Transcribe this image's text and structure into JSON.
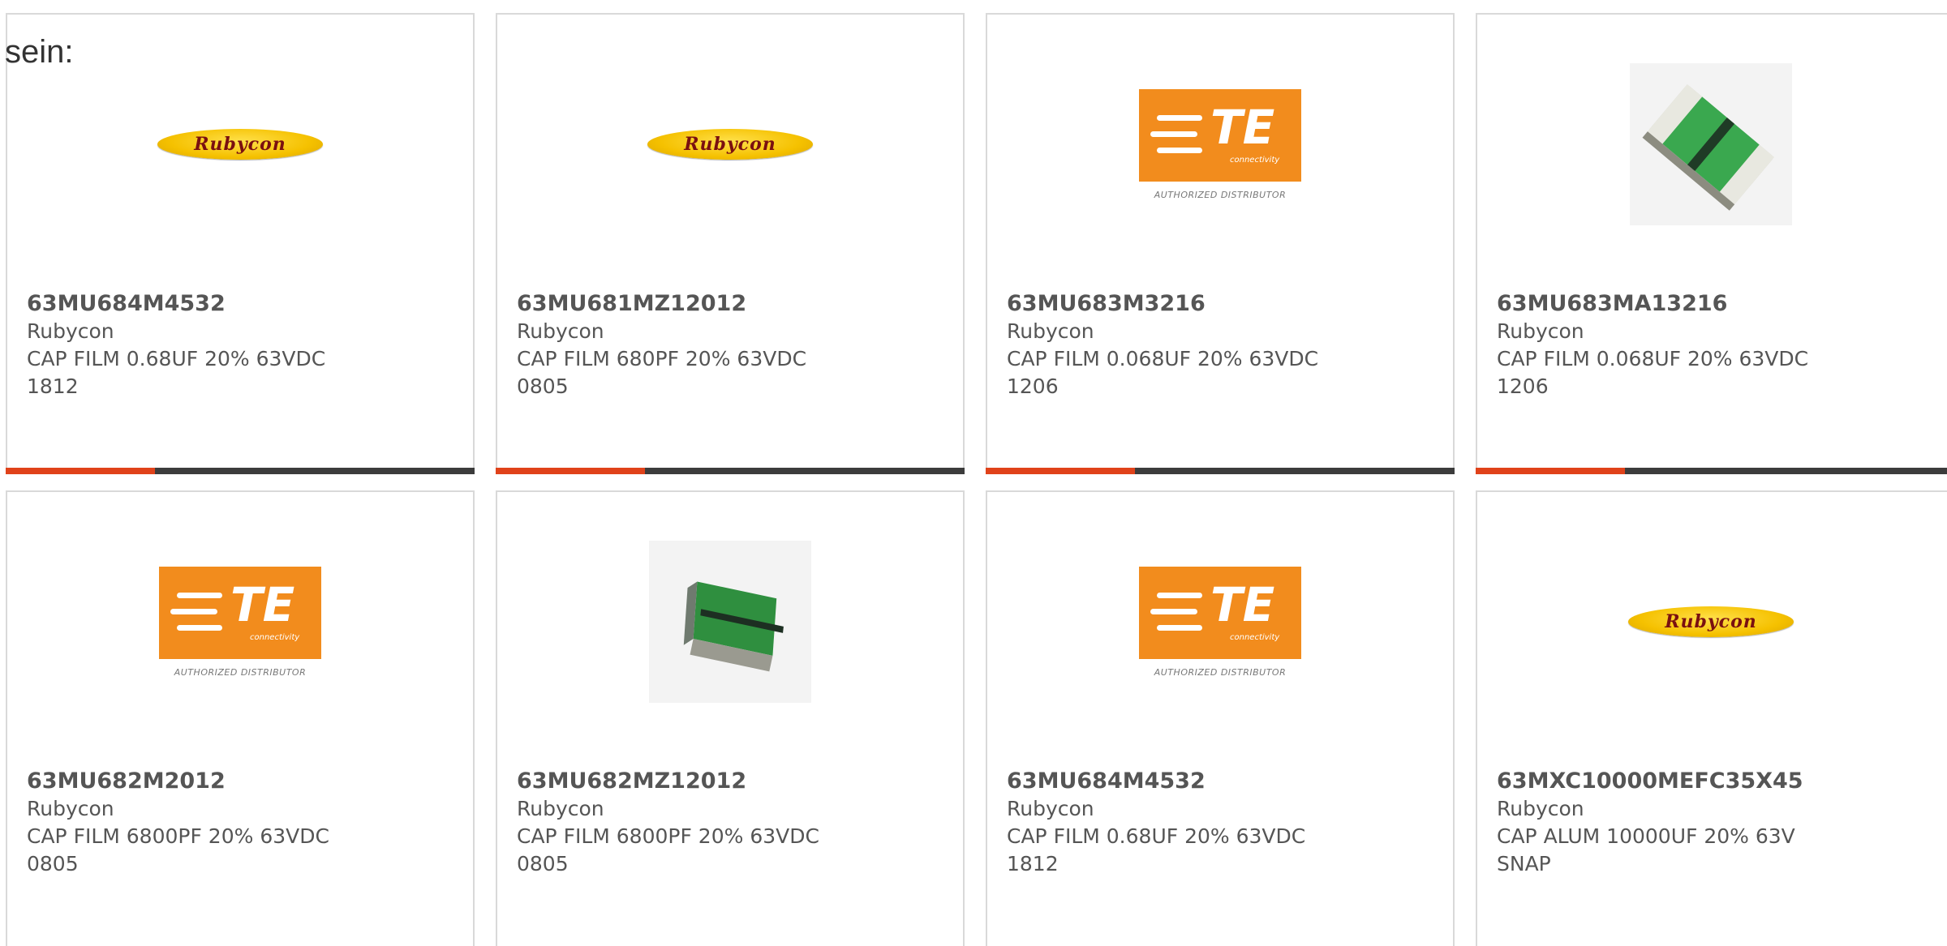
{
  "page": {
    "label": "sein:"
  },
  "products": [
    {
      "part_number": "63MU684M4532",
      "manufacturer": "Rubycon",
      "description": "CAP FILM 0.68UF 20% 63VDC",
      "package": "1812",
      "image": "rubycon-logo"
    },
    {
      "part_number": "63MU681MZ12012",
      "manufacturer": "Rubycon",
      "description": "CAP FILM 680PF 20% 63VDC",
      "package": "0805",
      "image": "rubycon-logo"
    },
    {
      "part_number": "63MU683M3216",
      "manufacturer": "Rubycon",
      "description": "CAP FILM 0.068UF 20% 63VDC",
      "package": "1206",
      "image": "te-logo"
    },
    {
      "part_number": "63MU683MA13216",
      "manufacturer": "Rubycon",
      "description": "CAP FILM 0.068UF 20% 63VDC",
      "package": "1206",
      "image": "chip-photo-tall"
    },
    {
      "part_number": "63MU682M2012",
      "manufacturer": "Rubycon",
      "description": "CAP FILM 6800PF 20% 63VDC",
      "package": "0805",
      "image": "te-logo"
    },
    {
      "part_number": "63MU682MZ12012",
      "manufacturer": "Rubycon",
      "description": "CAP FILM 6800PF 20% 63VDC",
      "package": "0805",
      "image": "chip-photo-square"
    },
    {
      "part_number": "63MU684M4532",
      "manufacturer": "Rubycon",
      "description": "CAP FILM 0.68UF 20% 63VDC",
      "package": "1812",
      "image": "te-logo"
    },
    {
      "part_number": "63MXC10000MEFC35X45",
      "manufacturer": "Rubycon",
      "description": "CAP ALUM 10000UF 20% 63V",
      "package": "SNAP",
      "image": "rubycon-logo"
    }
  ],
  "logos": {
    "rubycon_text": "Rubycon",
    "te_text": "TE",
    "te_sub": "connectivity",
    "te_distributor": "AUTHORIZED DISTRIBUTOR"
  },
  "colors": {
    "accent": "#e0421a",
    "bar": "#3c3c3c",
    "border": "#d9d9d9",
    "text": "#555555",
    "te_orange": "#f28c1d",
    "rubycon_yellow": "#f5c100"
  }
}
